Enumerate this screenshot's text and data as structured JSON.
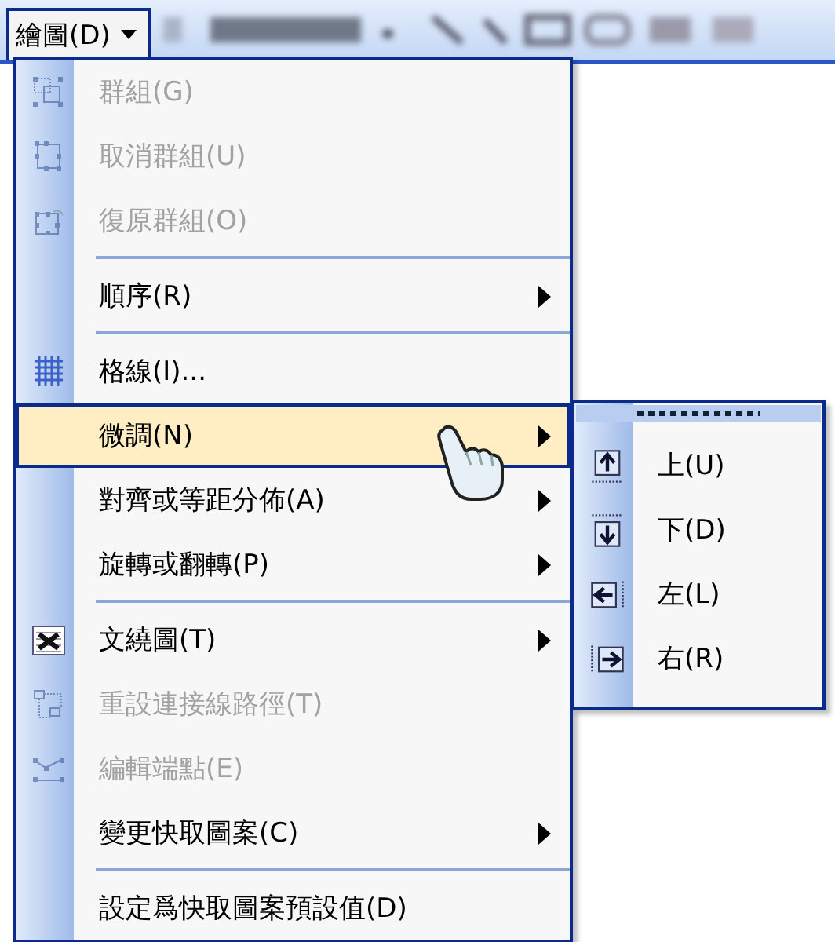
{
  "toolbar": {
    "menu_button": {
      "label": "繪圖(D)",
      "open": true
    }
  },
  "menu": {
    "items": [
      {
        "kind": "item",
        "label": "群組(G)",
        "disabled": true,
        "submenu": false,
        "selected": false
      },
      {
        "kind": "item",
        "label": "取消群組(U)",
        "disabled": true,
        "submenu": false,
        "selected": false
      },
      {
        "kind": "item",
        "label": "復原群組(O)",
        "disabled": true,
        "submenu": false,
        "selected": false
      },
      {
        "kind": "separator"
      },
      {
        "kind": "item",
        "label": "順序(R)",
        "disabled": false,
        "submenu": true,
        "selected": false
      },
      {
        "kind": "separator"
      },
      {
        "kind": "item",
        "label": "格線(I)...",
        "disabled": false,
        "submenu": false,
        "selected": false
      },
      {
        "kind": "item",
        "label": "微調(N)",
        "disabled": false,
        "submenu": true,
        "selected": true
      },
      {
        "kind": "item",
        "label": "對齊或等距分佈(A)",
        "disabled": false,
        "submenu": true,
        "selected": false
      },
      {
        "kind": "item",
        "label": "旋轉或翻轉(P)",
        "disabled": false,
        "submenu": true,
        "selected": false
      },
      {
        "kind": "separator"
      },
      {
        "kind": "item",
        "label": "文繞圖(T)",
        "disabled": false,
        "submenu": true,
        "selected": false
      },
      {
        "kind": "item",
        "label": "重設連接線路徑(T)",
        "disabled": true,
        "submenu": false,
        "selected": false
      },
      {
        "kind": "item",
        "label": "編輯端點(E)",
        "disabled": true,
        "submenu": false,
        "selected": false
      },
      {
        "kind": "item",
        "label": "變更快取圖案(C)",
        "disabled": false,
        "submenu": true,
        "selected": false
      },
      {
        "kind": "separator"
      },
      {
        "kind": "item",
        "label": "設定爲快取圖案預設值(D)",
        "disabled": false,
        "submenu": false,
        "selected": false
      }
    ]
  },
  "submenu": {
    "items": [
      {
        "label": "上(U)",
        "selected": false
      },
      {
        "label": "下(D)",
        "selected": false
      },
      {
        "label": "左(L)",
        "selected": false
      },
      {
        "label": "右(R)",
        "selected": false
      }
    ]
  }
}
